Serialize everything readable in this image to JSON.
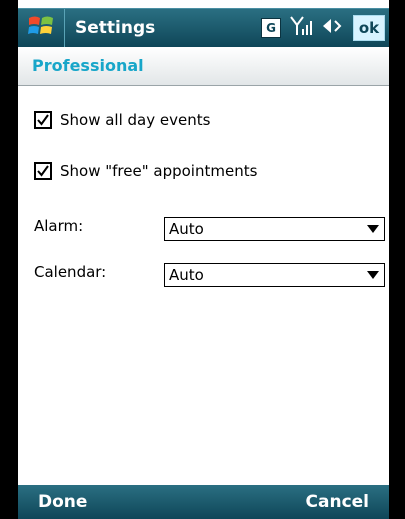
{
  "titlebar": {
    "app_title": "Settings",
    "status": {
      "network_badge": "G",
      "signal_icon": "signal-icon",
      "volume_icon": "volume-icon",
      "ok_label": "ok"
    }
  },
  "section": {
    "title": "Professional"
  },
  "options": {
    "show_all_day": {
      "label": "Show all day events",
      "checked": true
    },
    "show_free": {
      "label": "Show \"free\" appointments",
      "checked": true
    }
  },
  "alarm": {
    "label": "Alarm:",
    "selected": "Auto"
  },
  "calendar": {
    "label": "Calendar:",
    "selected": "Auto"
  },
  "softkeys": {
    "left": "Done",
    "right": "Cancel"
  },
  "colors": {
    "accent": "#18a6c9",
    "bar_top": "#2a6f82",
    "bar_bottom": "#0f4658"
  }
}
